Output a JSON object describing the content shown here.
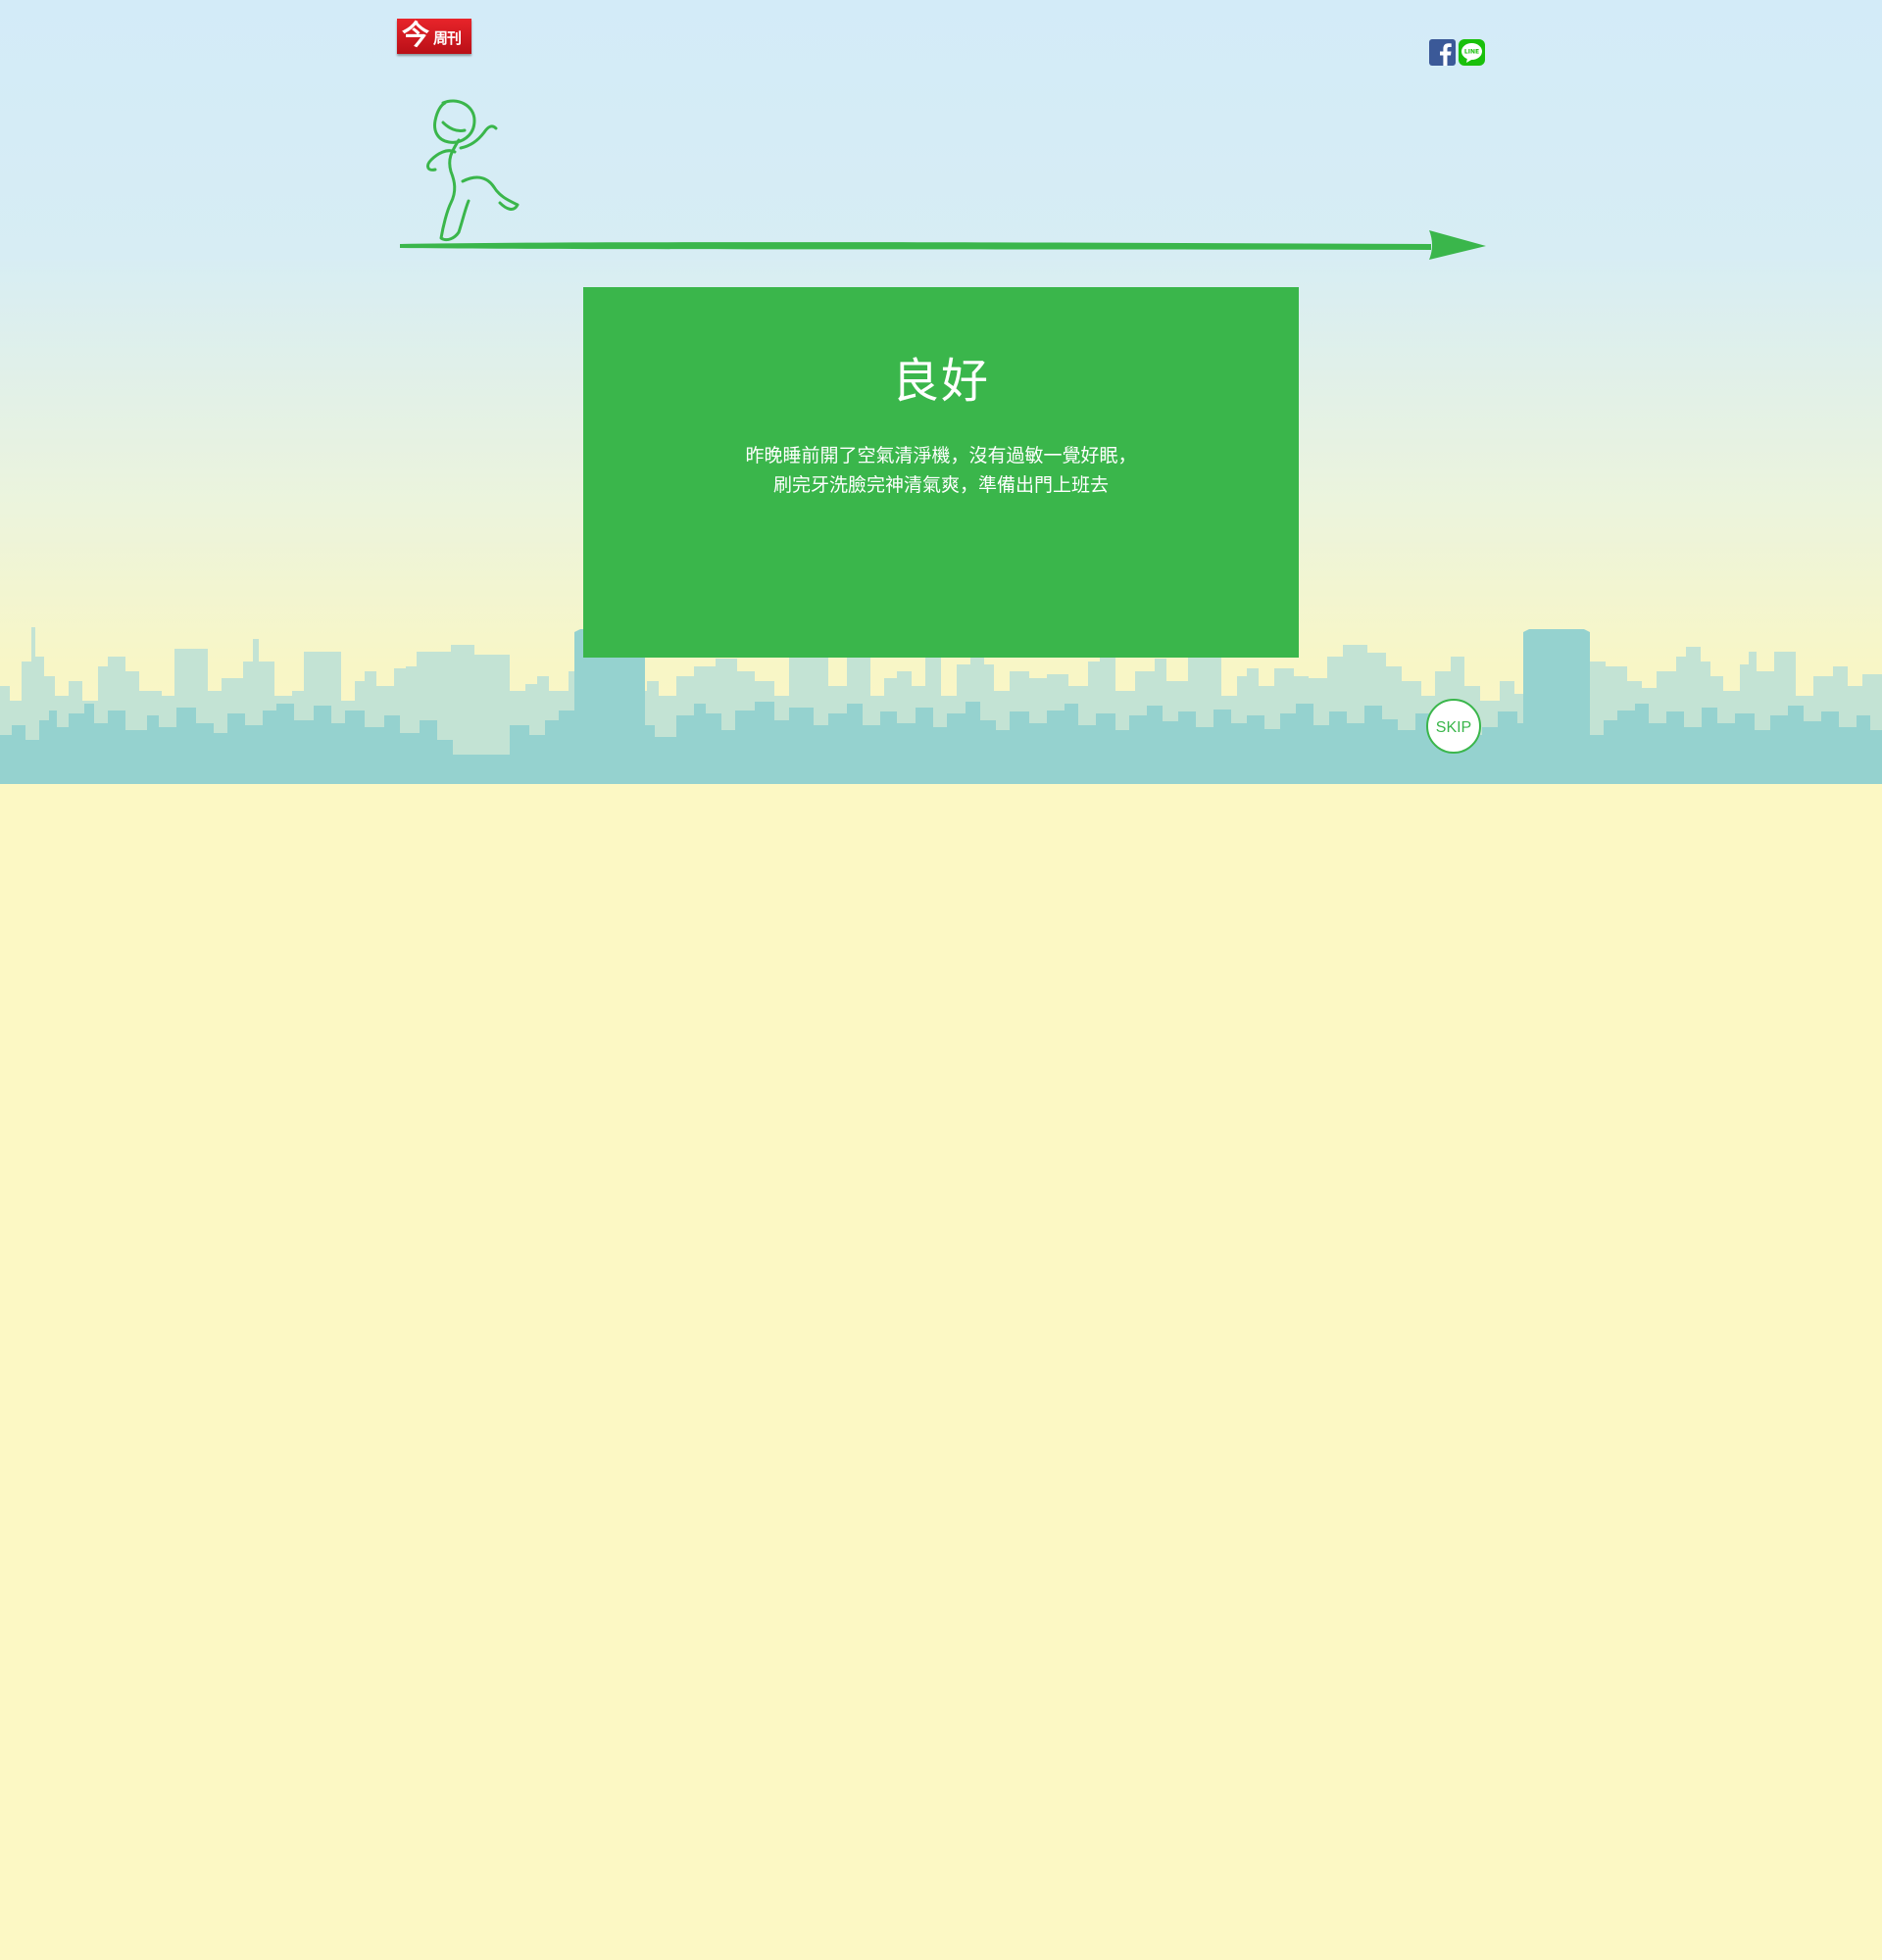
{
  "header": {
    "logo_text_big": "今",
    "logo_text_small": "周刊",
    "share": [
      {
        "name": "facebook",
        "icon": "facebook-icon",
        "color": "#3b5998"
      },
      {
        "name": "line",
        "icon": "line-icon",
        "label": "LINE",
        "color": "#19c00b"
      }
    ]
  },
  "card": {
    "title": "良好",
    "lines": [
      "昨晚睡前開了空氣清淨機，沒有過敏一覺好眠，",
      "刷完牙洗臉完神清氣爽，準備出門上班去"
    ],
    "color": "#3ab64b"
  },
  "skip_label": "SKIP",
  "colors": {
    "accent": "#3ab64b",
    "sky_top": "#d3ebf8",
    "ground": "#fcf8c4",
    "skyline_back": "#c2e3d4",
    "skyline_front": "#96d3cf"
  }
}
